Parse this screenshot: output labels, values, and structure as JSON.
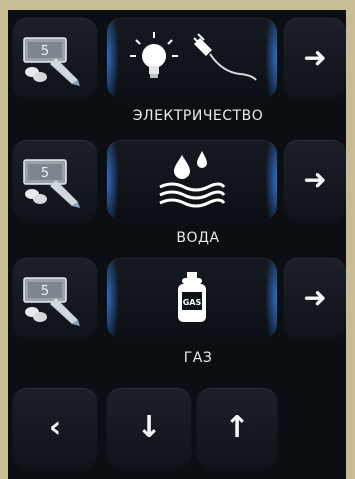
{
  "rows": [
    {
      "label": "ЭЛЕКТРИЧЕСТВО",
      "pay_icon": "payment-icon",
      "icon": "electricity-icon",
      "go_icon": "arrow-right-icon",
      "bill_text": "5"
    },
    {
      "label": "ВОДА",
      "pay_icon": "payment-icon",
      "icon": "water-icon",
      "go_icon": "arrow-right-icon",
      "bill_text": "5"
    },
    {
      "label": "ГАЗ",
      "pay_icon": "payment-icon",
      "icon": "gas-cylinder-icon",
      "go_icon": "arrow-right-icon",
      "bill_text": "5",
      "cylinder_text": "GAS"
    }
  ],
  "nav": {
    "back_glyph": "‹",
    "down_glyph": "↓",
    "up_glyph": "↑"
  },
  "colors": {
    "background": "#c7bd93",
    "panel": "#0b0e12",
    "accent_glow": "#3c8cff",
    "text": "#e9ebef"
  }
}
